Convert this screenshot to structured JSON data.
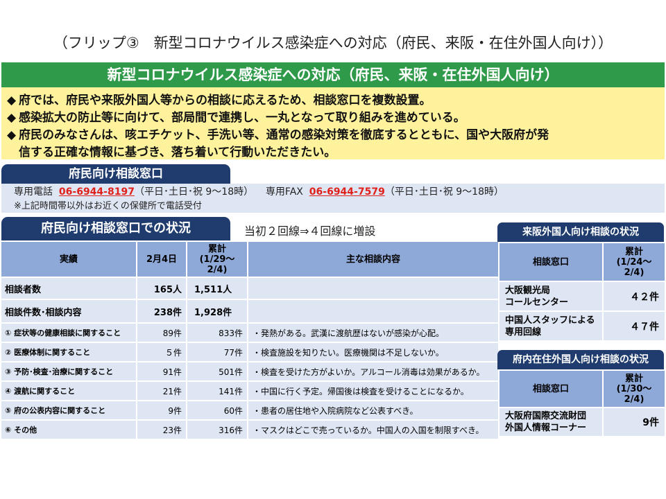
{
  "page_title": "（フリップ③　新型コロナウイルス感染症への対応（府民、来阪・在住外国人向け））",
  "banner_title": "新型コロナウイルス感染症への対応（府民、来阪・在住外国人向け）",
  "bullets": [
    {
      "marker": "◆",
      "text": "府では、府民や来阪外国人等からの相談に応えるため、相談窓口を複数設置。"
    },
    {
      "marker": "◆",
      "text": "感染拡大の防止等に向けて、部局間で連携し、一丸となって取り組みを進めている。"
    },
    {
      "marker": "◆",
      "text": "府民のみなさんは、咳エチケット、手洗い等、通常の感染対策を徹底するとともに、国や大阪府が発"
    },
    {
      "marker": "",
      "text": "信する正確な情報に基づき、落ち着いて行動いただきたい。"
    }
  ],
  "consult_window": {
    "tab": "府民向け相談窓口",
    "tel_label": "専用電話",
    "tel_number": "06-6944-8197",
    "tel_hours": "（平日･土日･祝  9〜18時）",
    "fax_label": "専用FAX",
    "fax_number": "06-6944-7579",
    "fax_hours": "（平日･土日･祝  9〜18時）",
    "note": "※上記時間帯以外はお近くの保健所で電話受付"
  },
  "status": {
    "tab": "府民向け相談窓口での状況",
    "note": "当初２回線⇒４回線に増設",
    "headers": {
      "c1": "実績",
      "c2": "2月4日",
      "c3a": "累計",
      "c3b": "(1/29〜",
      "c3c": "2/4)",
      "c4": "主な相談内容"
    },
    "rows": [
      {
        "label": "相談者数",
        "day": "165人",
        "total": "1,511人",
        "desc": ""
      },
      {
        "label": "相談件数･相談内容",
        "day": "238件",
        "total": "1,928件",
        "desc": ""
      },
      {
        "label": "①  症状等の健康相談に関すること",
        "day": "89件",
        "total": "833件",
        "desc": "・発熱がある。武漢に渡航歴はないが感染が心配。"
      },
      {
        "label": "②  医療体制に関すること",
        "day": "５件",
        "total": "77件",
        "desc": "・検査施設を知りたい。医療機関は不足しないか。"
      },
      {
        "label": "③  予防･検査･治療に関すること",
        "day": "91件",
        "total": "501件",
        "desc": "・検査を受けた方がよいか。アルコール消毒は効果があるか。"
      },
      {
        "label": "④  渡航に関すること",
        "day": "21件",
        "total": "141件",
        "desc": "・中国に行く予定。帰国後は検査を受けることになるか。"
      },
      {
        "label": "⑤  府の公表内容に関すること",
        "day": "9件",
        "total": "60件",
        "desc": "・患者の居住地や入院病院など公表すべき。"
      },
      {
        "label": "⑥  その他",
        "day": "23件",
        "total": "316件",
        "desc": "・マスクはどこで売っているか。中国人の入国を制限すべき。"
      }
    ]
  },
  "visitor": {
    "tab": "来阪外国人向け相談の状況",
    "h1": "相談窓口",
    "h2a": "累計",
    "h2b": "(1/24〜",
    "h2c": "2/4)",
    "rows": [
      {
        "name1": "大阪観光局",
        "name2": "コールセンター",
        "value": "４２件"
      },
      {
        "name1": "中国人スタッフによる",
        "name2": "専用回線",
        "value": "４７件"
      }
    ]
  },
  "resident": {
    "tab": "府内在住外国人向け相談の状況",
    "h1": "相談窓口",
    "h2a": "累計",
    "h2b": "(1/30〜",
    "h2c": "2/4)",
    "rows": [
      {
        "name1": "大阪府国際交流財団",
        "name2": "外国人情報コーナー",
        "value": "9件"
      }
    ]
  },
  "colors": {
    "banner": "#2f9a4a",
    "yellow": "#fff29c",
    "navy": "#203c6e",
    "header_blue": "#8ea8d8",
    "cell_blue": "#dfe6f3",
    "phone_red": "#e0201b"
  }
}
